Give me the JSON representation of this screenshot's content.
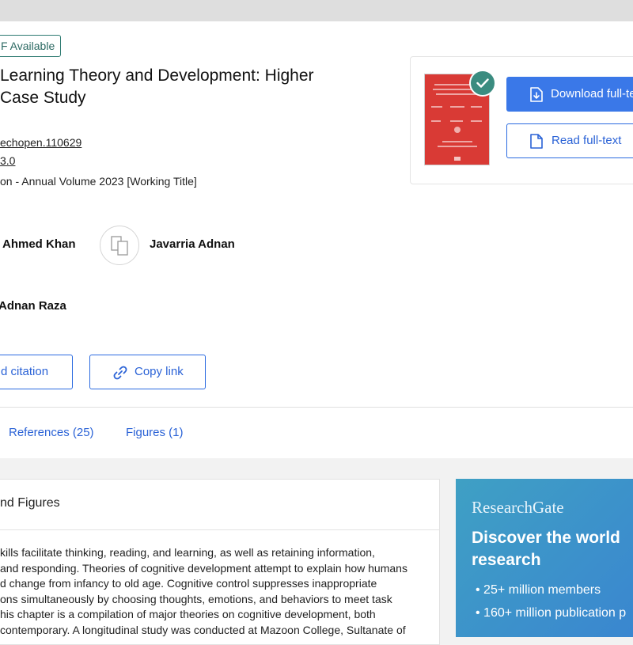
{
  "header": {
    "badge": "F Available",
    "title_line1": "Learning Theory and Development: Higher",
    "title_line2": "Case Study"
  },
  "meta": {
    "doi": "echopen.110629",
    "license": " 3.0",
    "book": "on - Annual Volume 2023 [Working Title]"
  },
  "authors": [
    {
      "name": "Ahmed Khan"
    },
    {
      "name": "Javarria Adnan"
    },
    {
      "name": "Adnan Raza"
    }
  ],
  "actions": {
    "cite_label": "d citation",
    "copy_label": "Copy link"
  },
  "tabs": {
    "references": "References (25)",
    "figures": "Figures (1)"
  },
  "sidebar": {
    "download_label": "Download full-te",
    "read_label": "Read full-text"
  },
  "abstract_section": {
    "heading": "nd Figures",
    "lines": [
      "kills facilitate thinking, reading, and learning, as well as retaining information,",
      "and responding. Theories of cognitive development attempt to explain how humans",
      "d change from infancy to old age. Cognitive control suppresses inappropriate",
      "ons simultaneously by choosing thoughts, emotions, and behaviors to meet task",
      "his chapter is a compilation of major theories on cognitive development, both",
      "contemporary. A longitudinal study was conducted at Mazoon College, Sultanate of"
    ]
  },
  "promo": {
    "brand": "ResearchGate",
    "headline_line1": "Discover the world",
    "headline_line2": "research",
    "items": [
      "25+ million members",
      "160+ million publication p"
    ]
  },
  "colors": {
    "accent": "#3a78e8",
    "badge_green": "#2d7a71",
    "check_green": "#3b8c80",
    "cover_red": "#d93a35"
  }
}
